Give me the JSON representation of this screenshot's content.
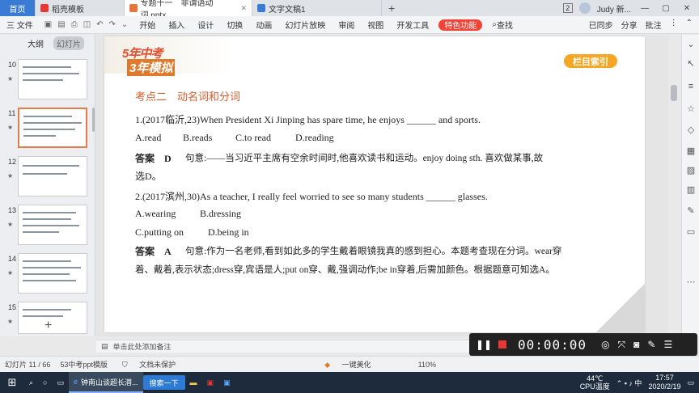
{
  "tabs": [
    {
      "label": "首页",
      "kind": "home"
    },
    {
      "label": "稻壳模板",
      "kind": "docer"
    },
    {
      "label": "专题十一　非谓语动词.pptx",
      "kind": "ppt",
      "active": true
    },
    {
      "label": "文字文稿1",
      "kind": "doc"
    }
  ],
  "tabbar_right": {
    "badge": "2",
    "user": "Judy 新..."
  },
  "menu": {
    "file": "三 文件",
    "items": [
      "开始",
      "插入",
      "设计",
      "切换",
      "动画",
      "幻灯片放映",
      "审阅",
      "视图",
      "开发工具"
    ],
    "special": "特色功能",
    "search": "查找",
    "right": [
      "已同步",
      "分享",
      "批注"
    ]
  },
  "left_panel": {
    "tabs": [
      "大纲",
      "幻灯片"
    ],
    "slides": [
      10,
      11,
      12,
      13,
      14,
      15
    ],
    "active_slide": 11
  },
  "slide": {
    "logo_top": "5年中考",
    "logo_bottom": "3年模拟",
    "index_button": "栏目索引",
    "section_title": "考点二　动名词和分词",
    "q1": "1.(2017临沂,23)When President Xi Jinping has spare time, he enjoys ______ and sports.",
    "q1_options": [
      "A.read",
      "B.reads",
      "C.to read",
      "D.reading"
    ],
    "a1_label": "答案　D",
    "a1_text": "句意:——当习近平主席有空余时间时,他喜欢读书和运动。enjoy doing sth. 喜欢做某事,故",
    "a1_text2": "选D。",
    "q2": "2.(2017滨州,30)As a teacher, I really feel worried to see so many students ______ glasses.",
    "q2_options": [
      "A.wearing",
      "B.dressing",
      "C.putting on",
      "D.being in"
    ],
    "a2_label": "答案　A",
    "a2_text": "句意:作为一名老师,看到如此多的学生戴着眼镜我真的感到担心。本题考查现在分词。wear穿",
    "a2_text2": "着、戴着,表示状态;dress穿,宾语是人;put on穿、戴,强调动作;be in穿着,后需加颜色。根据题意可知选A。"
  },
  "notes_placeholder": "单击此处添加备注",
  "status": {
    "slide_info": "幻灯片 11 / 66",
    "theme": "53中考ppt模版",
    "save_state": "文档未保护",
    "beautify": "一键美化",
    "zoom": "110%"
  },
  "recorder": {
    "time": "00:00:00"
  },
  "taskbar": {
    "app": "钟南山谈超长潜...",
    "search": "搜索一下",
    "temp": "44℃",
    "temp_label": "CPU温度",
    "time": "17:57",
    "date": "2020/2/19"
  }
}
